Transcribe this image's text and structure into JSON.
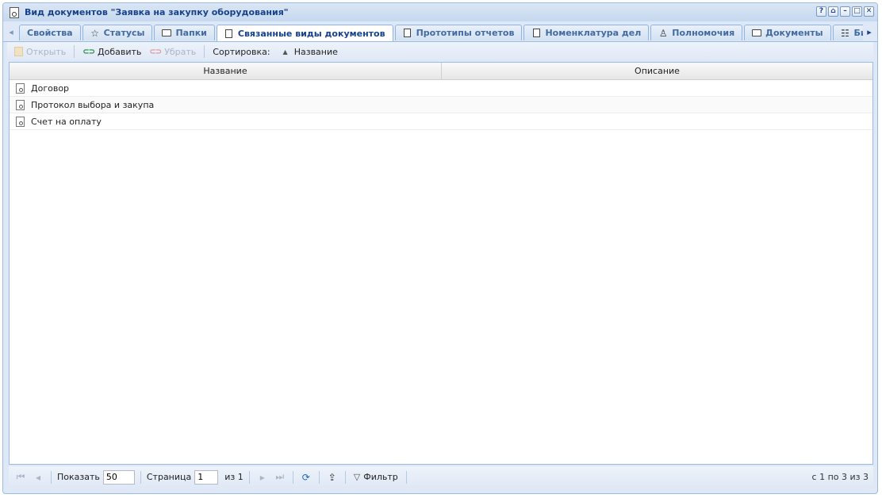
{
  "window": {
    "title": "Вид документов \"Заявка на закупку оборудования\"",
    "tools": [
      "?",
      "⌂",
      "–",
      "□",
      "✕"
    ]
  },
  "tabs": [
    {
      "label": "Свойства",
      "icon": "none"
    },
    {
      "label": "Статусы",
      "icon": "star-icon"
    },
    {
      "label": "Папки",
      "icon": "folder-icon"
    },
    {
      "label": "Связанные виды документов",
      "icon": "document-gear-icon",
      "active": true
    },
    {
      "label": "Прототипы отчетов",
      "icon": "report-icon"
    },
    {
      "label": "Номенклатура дел",
      "icon": "nomenclature-icon"
    },
    {
      "label": "Полномочия",
      "icon": "user-key-icon"
    },
    {
      "label": "Документы",
      "icon": "documents-icon"
    },
    {
      "label": "Бизнес-",
      "icon": "business-process-icon"
    }
  ],
  "toolbar": {
    "open_label": "Открыть",
    "add_label": "Добавить",
    "remove_label": "Убрать",
    "sort_label": "Сортировка:",
    "sort_field": "Название"
  },
  "grid": {
    "columns": [
      "Название",
      "Описание"
    ],
    "rows": [
      {
        "name": "Договор",
        "description": ""
      },
      {
        "name": "Протокол выбора и закупа",
        "description": ""
      },
      {
        "name": "Счет на оплату",
        "description": ""
      }
    ]
  },
  "pager": {
    "show_label": "Показать",
    "page_size": "50",
    "page_label": "Страница",
    "page": "1",
    "of_label": "из 1",
    "filter_label": "Фильтр",
    "count_text": "с 1 по 3 из 3"
  }
}
